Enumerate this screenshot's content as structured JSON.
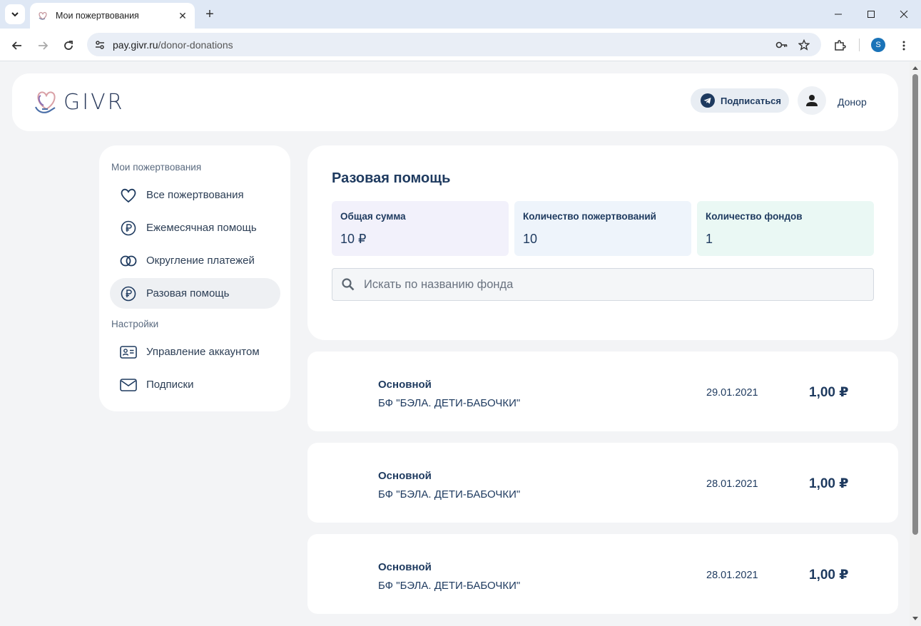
{
  "browser": {
    "tab_title": "Мои пожертвования",
    "url_host": "pay.givr.ru",
    "url_path": "/donor-donations",
    "profile_initial": "S"
  },
  "header": {
    "logo_text": "GIVR",
    "subscribe_label": "Подписаться",
    "user_label": "Донор"
  },
  "sidebar": {
    "section_donations": "Мои пожертвования",
    "items": [
      {
        "label": "Все пожертвования",
        "icon": "heart-icon"
      },
      {
        "label": "Ежемесячная помощь",
        "icon": "ruble-icon"
      },
      {
        "label": "Округление платежей",
        "icon": "rings-icon"
      },
      {
        "label": "Разовая помощь",
        "icon": "ruble-icon",
        "active": true
      }
    ],
    "section_settings": "Настройки",
    "settings_items": [
      {
        "label": "Управление аккаунтом",
        "icon": "id-card-icon"
      },
      {
        "label": "Подписки",
        "icon": "envelope-icon"
      }
    ]
  },
  "summary": {
    "title": "Разовая помощь",
    "stats": [
      {
        "label": "Общая сумма",
        "value": "10 ₽",
        "color": "#f2f1fb"
      },
      {
        "label": "Количество пожертвований",
        "value": "10",
        "color": "#eef4fb"
      },
      {
        "label": "Количество фондов",
        "value": "1",
        "color": "#eaf8f4"
      }
    ],
    "search_placeholder": "Искать по названию фонда"
  },
  "donations": [
    {
      "type": "Основной",
      "fund": "БФ \"БЭЛА. ДЕТИ-БАБОЧКИ\"",
      "date": "29.01.2021",
      "amount": "1,00 ₽"
    },
    {
      "type": "Основной",
      "fund": "БФ \"БЭЛА. ДЕТИ-БАБОЧКИ\"",
      "date": "28.01.2021",
      "amount": "1,00 ₽"
    },
    {
      "type": "Основной",
      "fund": "БФ \"БЭЛА. ДЕТИ-БАБОЧКИ\"",
      "date": "28.01.2021",
      "amount": "1,00 ₽"
    }
  ],
  "colors": {
    "accent": "#1e3a5f",
    "page_bg": "#f3f4f6",
    "active_item_bg": "#eef0f3"
  }
}
